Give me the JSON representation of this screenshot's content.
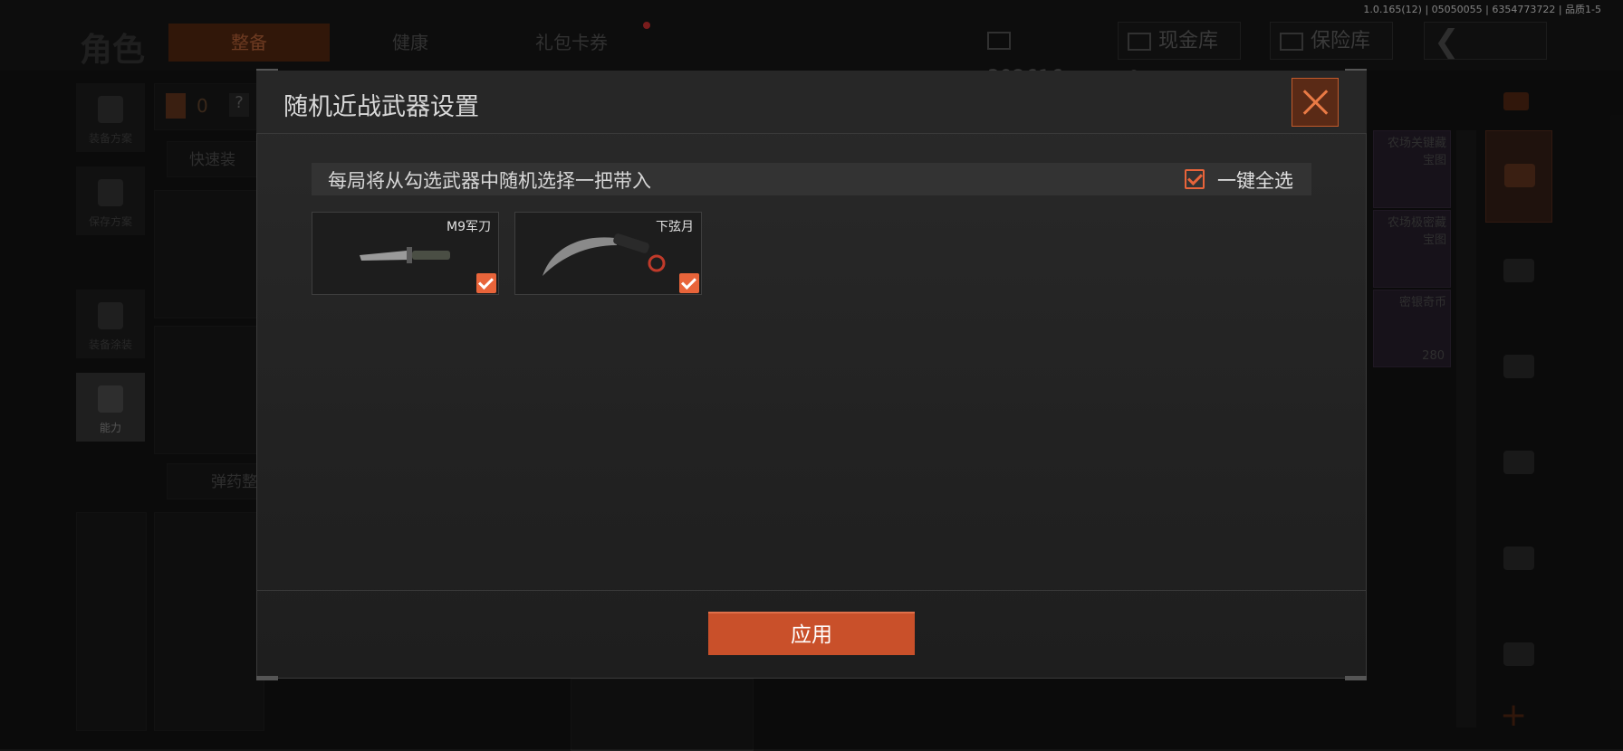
{
  "version_text": "1.0.165(12) | 05050055 | 6354773722 | 品质1-5",
  "background": {
    "title": "角色",
    "tabs": [
      {
        "label": "整备",
        "active": true
      },
      {
        "label": "健康",
        "active": false
      },
      {
        "label": "礼包卡券",
        "active": false
      }
    ],
    "currency_value": "392616",
    "cash_vault_label": "现金库 0",
    "safe_box_label": "保险库",
    "left_sidebar": [
      {
        "label": "装备方案"
      },
      {
        "label": "保存方案"
      },
      {
        "label": "装备涂装"
      },
      {
        "label": "能力"
      }
    ],
    "loadout_count": "0",
    "quick_equip_label": "快速装",
    "ammo_label": "弹药整",
    "loot_items": [
      {
        "label": "农场关键藏宝图",
        "count": ""
      },
      {
        "label": "农场极密藏宝图",
        "count": ""
      },
      {
        "label": "密银奇币",
        "count": "280"
      }
    ]
  },
  "modal": {
    "title": "随机近战武器设置",
    "description": "每局将从勾选武器中随机选择一把带入",
    "select_all_label": "一键全选",
    "select_all_checked": true,
    "weapons": [
      {
        "name": "M9军刀",
        "checked": true,
        "icon": "m9-bayonet"
      },
      {
        "name": "下弦月",
        "checked": true,
        "icon": "karambit"
      }
    ],
    "apply_label": "应用"
  },
  "colors": {
    "accent": "#e8643a",
    "button": "#c9502a",
    "modal_bg": "#262626"
  }
}
